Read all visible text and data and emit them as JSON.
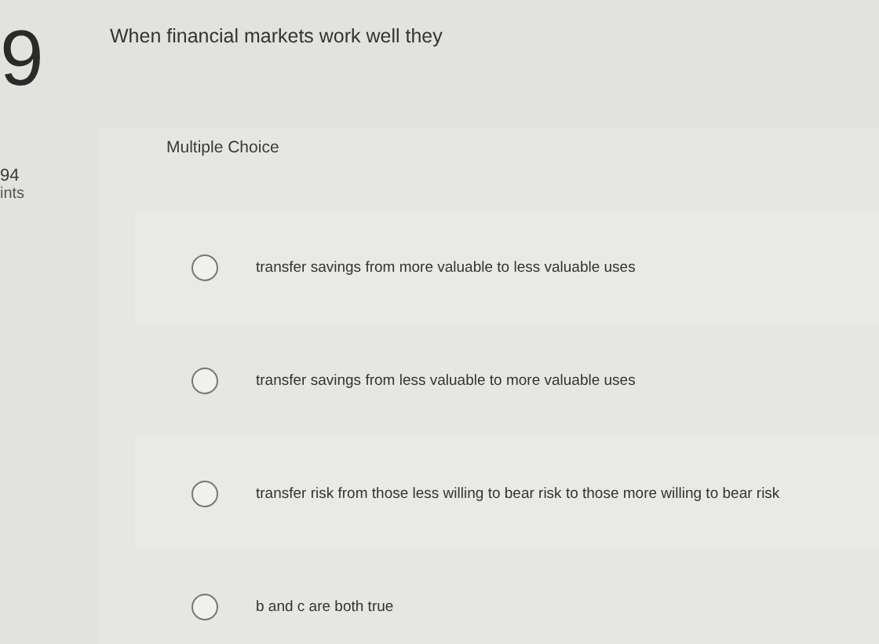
{
  "question": {
    "number": "9",
    "points": "94",
    "points_label": "ints",
    "text": "When financial markets work well they"
  },
  "question_type": "Multiple Choice",
  "options": [
    {
      "text": "transfer savings from more valuable to less valuable uses",
      "selected": false
    },
    {
      "text": "transfer savings from less valuable to more valuable uses",
      "selected": false
    },
    {
      "text": "transfer risk from those less willing to bear risk to those more willing to bear risk",
      "selected": false
    },
    {
      "text": "b and c are both true",
      "selected": false
    }
  ]
}
